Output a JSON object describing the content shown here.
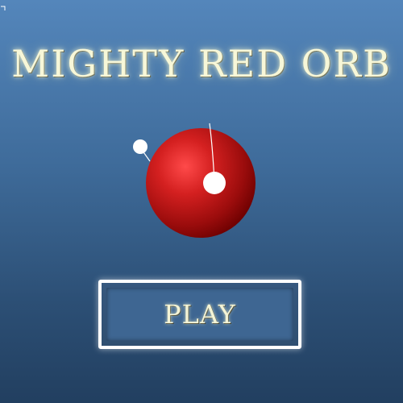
{
  "game": {
    "title": "MIGHTY RED ORB",
    "play_label": "PLAY"
  },
  "colors": {
    "orb": "#d42020",
    "orb_dark": "#6a0000",
    "title_glow": "#f7f7d8",
    "background_top": "#5486bb",
    "background_bottom": "#223f60"
  }
}
